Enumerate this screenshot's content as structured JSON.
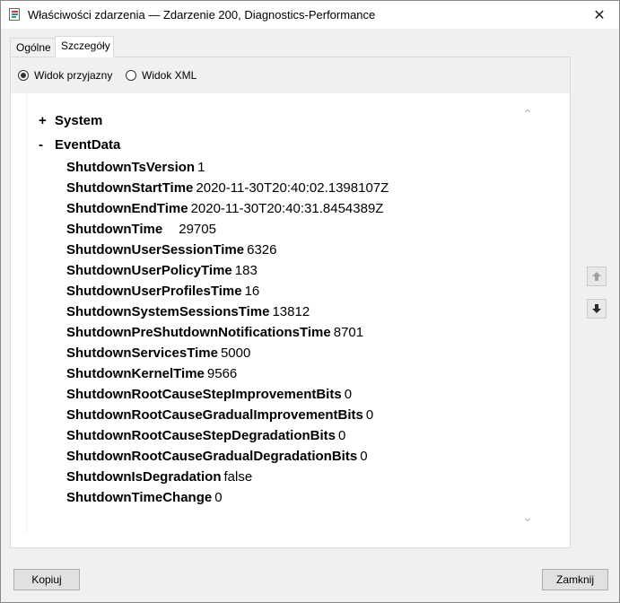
{
  "window": {
    "title": "Właściwości zdarzenia — Zdarzenie 200, Diagnostics-Performance",
    "close_glyph": "✕"
  },
  "tabs": [
    {
      "label": "Ogólne",
      "active": false
    },
    {
      "label": "Szczegóły",
      "active": true
    }
  ],
  "view_mode": {
    "options": [
      {
        "label": "Widok przyjazny",
        "selected": true
      },
      {
        "label": "Widok XML",
        "selected": false
      }
    ]
  },
  "tree": {
    "system": {
      "sign": "+",
      "label": "System"
    },
    "eventdata": {
      "sign": "-",
      "label": "EventData"
    },
    "fields": [
      {
        "name": "ShutdownTsVersion",
        "value": "1"
      },
      {
        "name": "ShutdownStartTime",
        "value": "2020-11-30T20:40:02.1398107Z"
      },
      {
        "name": "ShutdownEndTime",
        "value": "2020-11-30T20:40:31.8454389Z"
      },
      {
        "name": "ShutdownTime",
        "value": "29705"
      },
      {
        "name": "ShutdownUserSessionTime",
        "value": "6326"
      },
      {
        "name": "ShutdownUserPolicyTime",
        "value": "183"
      },
      {
        "name": "ShutdownUserProfilesTime",
        "value": "16"
      },
      {
        "name": "ShutdownSystemSessionsTime",
        "value": "13812"
      },
      {
        "name": "ShutdownPreShutdownNotificationsTime",
        "value": "8701"
      },
      {
        "name": "ShutdownServicesTime",
        "value": "5000"
      },
      {
        "name": "ShutdownKernelTime",
        "value": "9566"
      },
      {
        "name": "ShutdownRootCauseStepImprovementBits",
        "value": "0"
      },
      {
        "name": "ShutdownRootCauseGradualImprovementBits",
        "value": "0"
      },
      {
        "name": "ShutdownRootCauseStepDegradationBits",
        "value": "0"
      },
      {
        "name": "ShutdownRootCauseGradualDegradationBits",
        "value": "0"
      },
      {
        "name": "ShutdownIsDegradation",
        "value": "false"
      },
      {
        "name": "ShutdownTimeChange",
        "value": "0"
      }
    ]
  },
  "buttons": {
    "copy": "Kopiuj",
    "close": "Zamknij"
  },
  "icons": {
    "scroll_up": "chevron-up-icon",
    "scroll_down": "chevron-down-icon",
    "prev_event": "arrow-up-icon",
    "next_event": "arrow-down-icon",
    "app": "event-properties-icon"
  }
}
